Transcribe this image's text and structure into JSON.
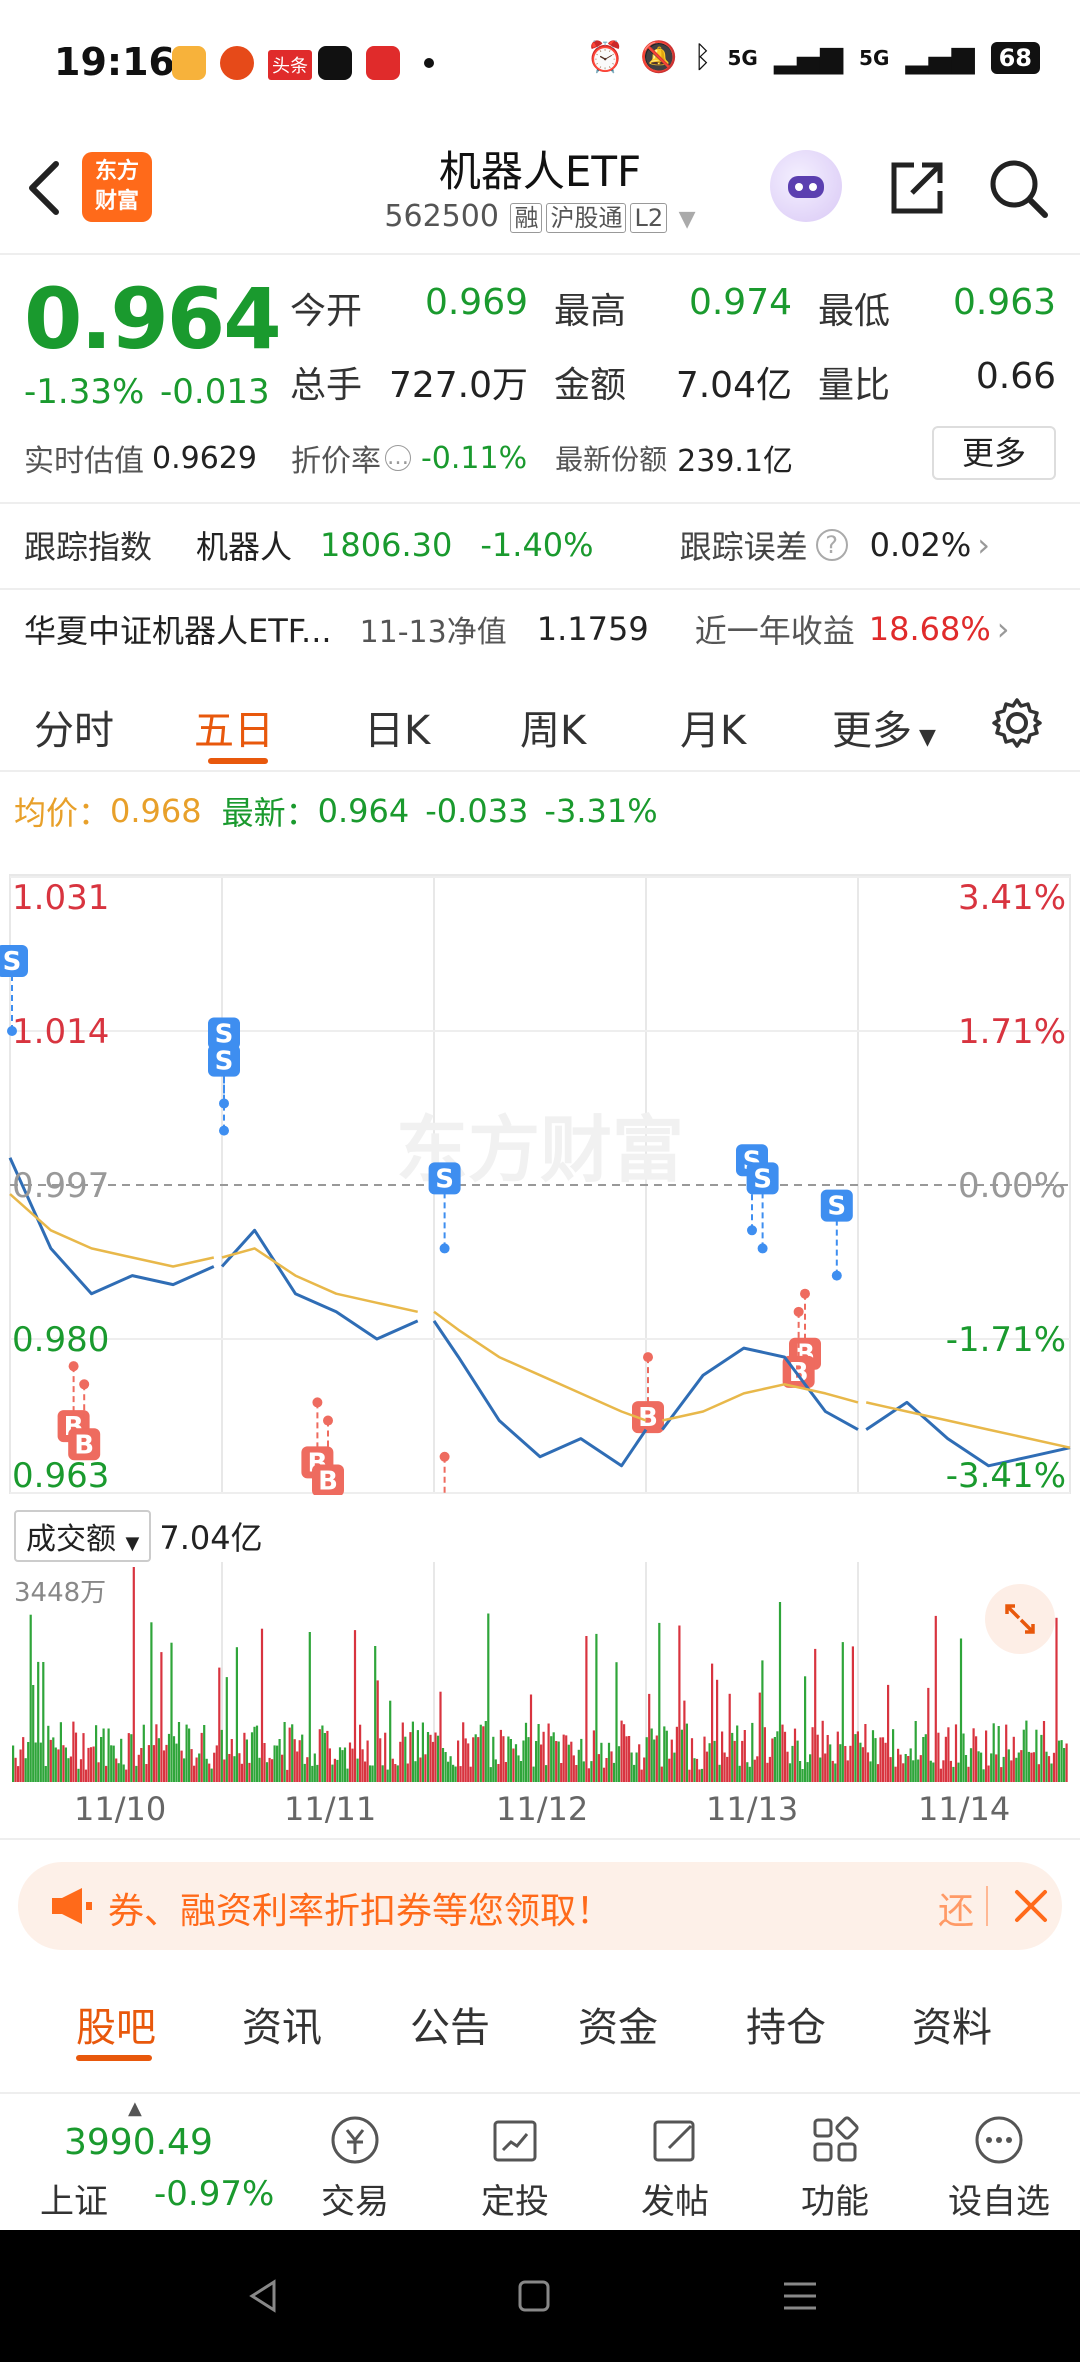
{
  "status_bar": {
    "time": "19:16",
    "app_badge": "头条",
    "signal1": "5G",
    "signal2": "5G",
    "battery": "68"
  },
  "header": {
    "logo_line1": "东方",
    "logo_line2": "财富",
    "title": "机器人ETF",
    "code": "562500",
    "tags": [
      "融",
      "沪股通",
      "L2"
    ]
  },
  "quote": {
    "price": "0.964",
    "pct": "-1.33%",
    "change": "-0.013",
    "open_label": "今开",
    "open": "0.969",
    "high_label": "最高",
    "high": "0.974",
    "low_label": "最低",
    "low": "0.963",
    "vol_label": "总手",
    "vol": "727.0万",
    "amount_label": "金额",
    "amount": "7.04亿",
    "ratio_label": "量比",
    "ratio": "0.66",
    "est_label": "实时估值",
    "est": "0.9629",
    "discount_label": "折价率",
    "discount": "-0.11%",
    "shares_label": "最新份额",
    "shares": "239.1亿",
    "more": "更多"
  },
  "index_row": {
    "label": "跟踪指数",
    "name": "机器人",
    "value": "1806.30",
    "pct": "-1.40%",
    "err_label": "跟踪误差",
    "err": "0.02%"
  },
  "fund_row": {
    "name": "华夏中证机器人ETF...",
    "nav_label": "11-13净值",
    "nav": "1.1759",
    "yr_label": "近一年收益",
    "yr": "18.68%"
  },
  "chart_tabs": [
    "分时",
    "五日",
    "日K",
    "周K",
    "月K",
    "更多"
  ],
  "avg_row": {
    "avg_label": "均价：",
    "avg": "0.968",
    "latest_label": "最新：",
    "latest": "0.964",
    "chg": "-0.033",
    "pct": "-3.31%"
  },
  "chart_data": {
    "type": "line",
    "x": [
      "11/10",
      "11/11",
      "11/12",
      "11/13",
      "11/14"
    ],
    "y_ticks_left": [
      "1.031",
      "1.014",
      "0.997",
      "0.980",
      "0.963"
    ],
    "y_ticks_right": [
      "3.41%",
      "1.71%",
      "0.00%",
      "-1.71%",
      "-3.41%"
    ],
    "ylim": [
      0.963,
      1.031
    ],
    "watermark": "东方财富",
    "series": [
      {
        "values": [
          1.0,
          0.99,
          0.985,
          0.987,
          0.986,
          0.988,
          0.992,
          0.985,
          0.983,
          0.98,
          0.982,
          0.978,
          0.971,
          0.967,
          0.969,
          0.966,
          0.97,
          0.976,
          0.979,
          0.978,
          0.972,
          0.97,
          0.973,
          0.969,
          0.966,
          0.967,
          0.968
        ]
      },
      {
        "values": [
          0.996,
          0.992,
          0.99,
          0.989,
          0.988,
          0.989,
          0.99,
          0.987,
          0.985,
          0.984,
          0.983,
          0.981,
          0.978,
          0.976,
          0.974,
          0.972,
          0.971,
          0.972,
          0.974,
          0.975,
          0.974,
          0.973,
          0.972,
          0.971,
          0.97,
          0.969,
          0.968
        ]
      }
    ],
    "trade_marks": [
      {
        "type": "S",
        "day_pos": 0.0,
        "price": 1.014
      },
      {
        "type": "S",
        "day_pos": 1.0,
        "price": 1.006
      },
      {
        "type": "S",
        "day_pos": 1.0,
        "price": 1.003
      },
      {
        "type": "S",
        "day_pos": 2.05,
        "price": 0.99
      },
      {
        "type": "S",
        "day_pos": 3.5,
        "price": 0.992
      },
      {
        "type": "S",
        "day_pos": 3.55,
        "price": 0.99
      },
      {
        "type": "S",
        "day_pos": 3.9,
        "price": 0.987
      },
      {
        "type": "B",
        "day_pos": 0.3,
        "price": 0.977
      },
      {
        "type": "B",
        "day_pos": 0.35,
        "price": 0.975
      },
      {
        "type": "B",
        "day_pos": 1.45,
        "price": 0.973
      },
      {
        "type": "B",
        "day_pos": 1.5,
        "price": 0.971
      },
      {
        "type": "B",
        "day_pos": 2.05,
        "price": 0.967
      },
      {
        "type": "B",
        "day_pos": 3.0,
        "price": 0.978
      },
      {
        "type": "B",
        "day_pos": 3.75,
        "price": 0.985
      },
      {
        "type": "B",
        "day_pos": 3.72,
        "price": 0.983
      }
    ]
  },
  "volume": {
    "label": "成交额",
    "value": "7.04亿",
    "max": "3448万"
  },
  "promo": {
    "text": "券、融资利率折扣券等您领取！",
    "return": "还"
  },
  "bottom_tabs": [
    "股吧",
    "资讯",
    "公告",
    "资金",
    "持仓",
    "资料"
  ],
  "toolbar": {
    "index_value": "3990.49",
    "index_label": "上证",
    "index_pct": "-0.97%",
    "items": [
      "交易",
      "定投",
      "发帖",
      "功能",
      "设自选"
    ]
  },
  "colors": {
    "up": "#e02b2b",
    "down": "#1a9a2e",
    "accent": "#e8580c",
    "price_line": "#2f6db5",
    "avg_line": "#e8b84a"
  }
}
